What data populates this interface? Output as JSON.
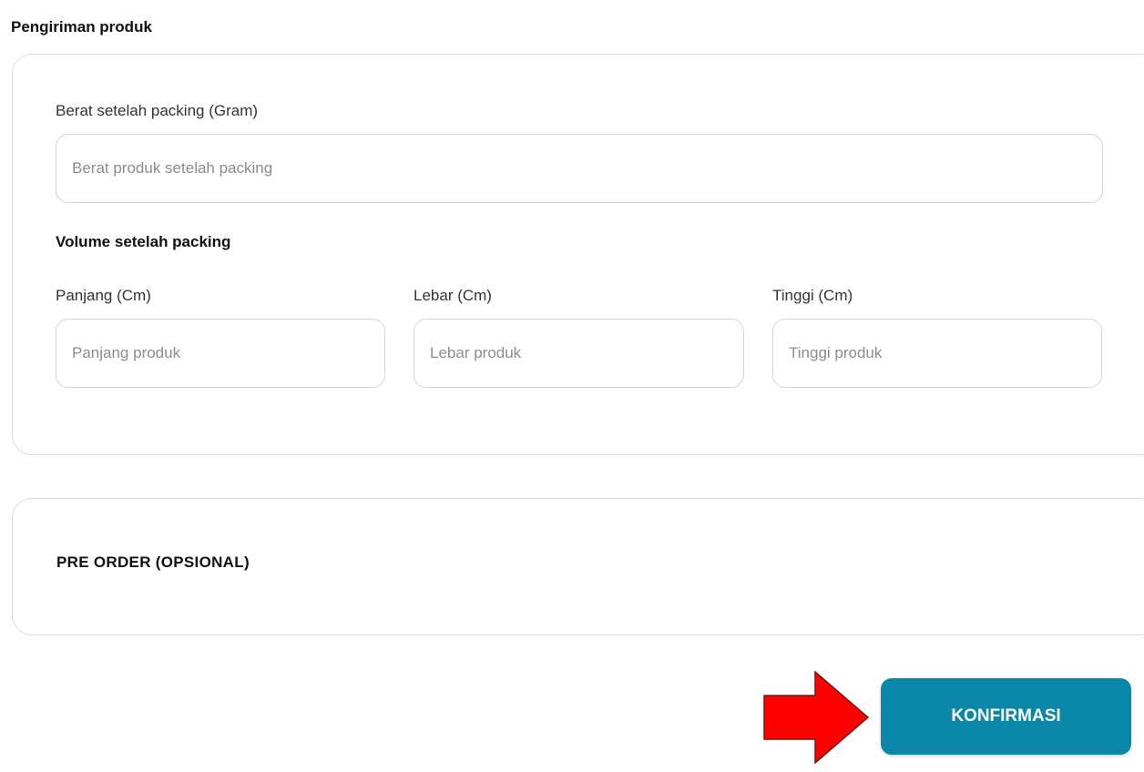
{
  "section_title": "Pengiriman produk",
  "shipping": {
    "weight": {
      "label": "Berat setelah packing (Gram)",
      "placeholder": "Berat produk setelah packing",
      "value": ""
    },
    "volume_heading": "Volume setelah packing",
    "length": {
      "label": "Panjang (Cm)",
      "placeholder": "Panjang produk",
      "value": ""
    },
    "width": {
      "label": "Lebar (Cm)",
      "placeholder": "Lebar produk",
      "value": ""
    },
    "height": {
      "label": "Tinggi (Cm)",
      "placeholder": "Tinggi produk",
      "value": ""
    }
  },
  "preorder": {
    "title": "PRE ORDER (OPSIONAL)"
  },
  "actions": {
    "confirm_label": "KONFIRMASI"
  },
  "colors": {
    "confirm_button": "#0a87a8",
    "arrow_fill": "#ff0000",
    "border": "#d4d4d4"
  },
  "annotation": {
    "icon": "right-arrow-icon"
  }
}
